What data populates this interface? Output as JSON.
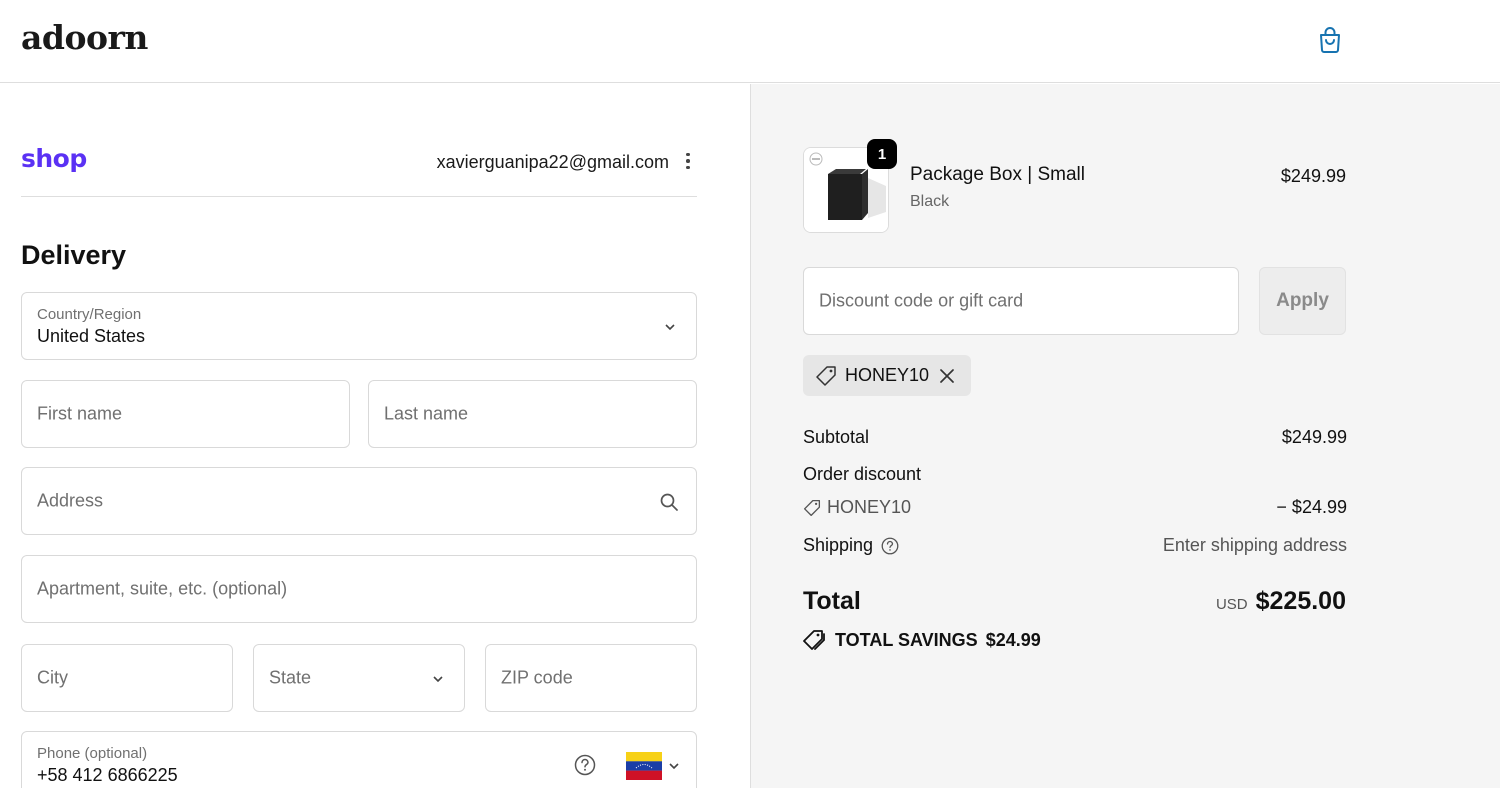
{
  "header": {
    "logo": "adoorn",
    "cart_icon": "shopping-bag-icon"
  },
  "shop_pay": {
    "logo": "shop",
    "email": "xavierguanipa22@gmail.com",
    "menu_icon": "kebab-menu-icon"
  },
  "delivery": {
    "title": "Delivery",
    "country": {
      "label": "Country/Region",
      "value": "United States"
    },
    "first_name": {
      "placeholder": "First name"
    },
    "last_name": {
      "placeholder": "Last name"
    },
    "address": {
      "placeholder": "Address"
    },
    "apartment": {
      "placeholder": "Apartment, suite, etc. (optional)"
    },
    "city": {
      "placeholder": "City"
    },
    "state": {
      "placeholder": "State"
    },
    "zip": {
      "placeholder": "ZIP code"
    },
    "phone": {
      "label": "Phone (optional)",
      "value": "+58 412 6866225",
      "flag": "venezuela-flag"
    }
  },
  "order": {
    "product": {
      "name": "Package Box | Small",
      "variant": "Black",
      "price": "$249.99",
      "quantity": "1"
    },
    "discount_placeholder": "Discount code or gift card",
    "apply_label": "Apply",
    "applied_code": "HONEY10",
    "subtotal_label": "Subtotal",
    "subtotal_value": "$249.99",
    "order_discount_label": "Order discount",
    "discount_code": "HONEY10",
    "discount_value": "− $24.99",
    "shipping_label": "Shipping",
    "shipping_value": "Enter shipping address",
    "total_label": "Total",
    "currency": "USD",
    "total_value": "$225.00",
    "savings_label": "TOTAL SAVINGS",
    "savings_value": "$24.99"
  },
  "colors": {
    "brand_shop": "#5a31f4",
    "cart_icon": "#1773b0",
    "summary_bg": "#f5f5f5"
  }
}
